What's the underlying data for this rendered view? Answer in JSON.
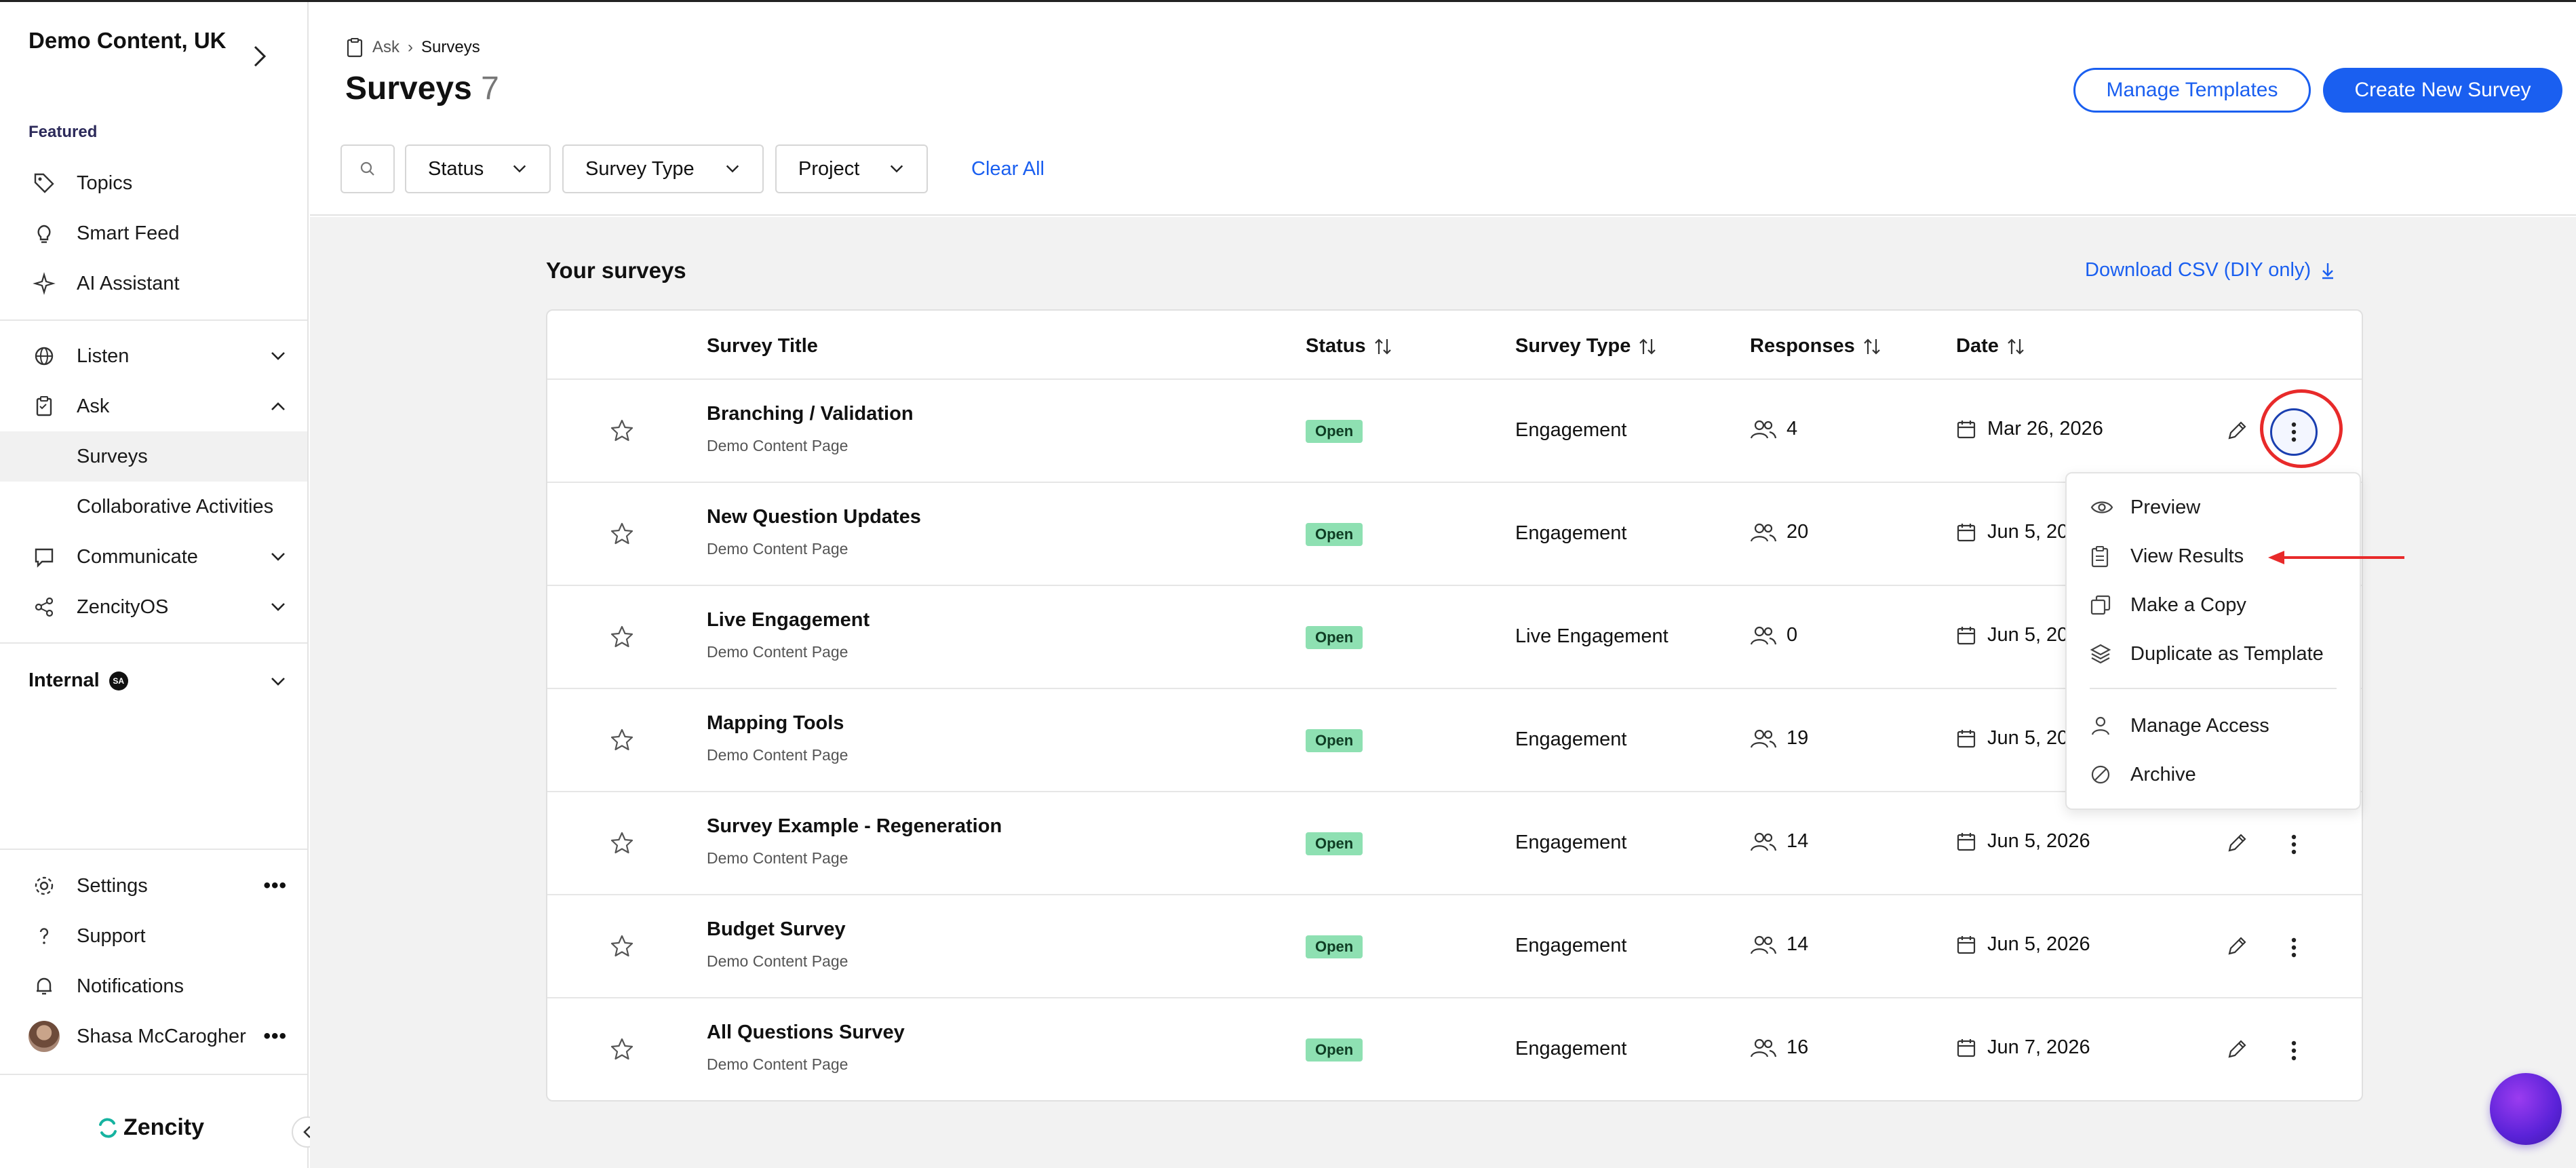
{
  "sidebar": {
    "org_name": "Demo Content, UK",
    "featured_label": "Featured",
    "items": [
      {
        "label": "Topics"
      },
      {
        "label": "Smart Feed"
      },
      {
        "label": "AI Assistant"
      },
      {
        "label": "Listen"
      },
      {
        "label": "Ask"
      },
      {
        "label": "Surveys"
      },
      {
        "label": "Collaborative Activities"
      },
      {
        "label": "Communicate"
      },
      {
        "label": "ZencityOS"
      }
    ],
    "internal_label": "Internal",
    "internal_badge": "SA",
    "bottom": [
      {
        "label": "Settings"
      },
      {
        "label": "Support"
      },
      {
        "label": "Notifications"
      },
      {
        "label": "Shasa McCarogher"
      }
    ],
    "logo_text": "Zencity"
  },
  "header": {
    "breadcrumb": [
      "Ask",
      "Surveys"
    ],
    "title": "Surveys",
    "count": "7",
    "manage_templates": "Manage Templates",
    "create_survey": "Create New Survey",
    "filters": [
      "Status",
      "Survey Type",
      "Project"
    ],
    "clear_all": "Clear All"
  },
  "main": {
    "section_title": "Your surveys",
    "download_csv": "Download CSV (DIY only)",
    "columns": [
      "Survey Title",
      "Status",
      "Survey Type",
      "Responses",
      "Date"
    ],
    "rows": [
      {
        "title": "Branching / Validation",
        "page": "Demo Content Page",
        "status": "Open",
        "type": "Engagement",
        "responses": "4",
        "date": "Mar 26, 2026"
      },
      {
        "title": "New Question Updates",
        "page": "Demo Content Page",
        "status": "Open",
        "type": "Engagement",
        "responses": "20",
        "date": "Jun 5, 2026"
      },
      {
        "title": "Live Engagement",
        "page": "Demo Content Page",
        "status": "Open",
        "type": "Live Engagement",
        "responses": "0",
        "date": "Jun 5, 2026"
      },
      {
        "title": "Mapping Tools",
        "page": "Demo Content Page",
        "status": "Open",
        "type": "Engagement",
        "responses": "19",
        "date": "Jun 5, 2026"
      },
      {
        "title": "Survey Example - Regeneration",
        "page": "Demo Content Page",
        "status": "Open",
        "type": "Engagement",
        "responses": "14",
        "date": "Jun 5, 2026"
      },
      {
        "title": "Budget Survey",
        "page": "Demo Content Page",
        "status": "Open",
        "type": "Engagement",
        "responses": "14",
        "date": "Jun 5, 2026"
      },
      {
        "title": "All Questions Survey",
        "page": "Demo Content Page",
        "status": "Open",
        "type": "Engagement",
        "responses": "16",
        "date": "Jun 7, 2026"
      }
    ]
  },
  "menu": {
    "items": [
      {
        "label": "Preview",
        "icon": "eye-icon"
      },
      {
        "label": "View Results",
        "icon": "clipboard-icon"
      },
      {
        "label": "Make a Copy",
        "icon": "copy-icon"
      },
      {
        "label": "Duplicate as Template",
        "icon": "layers-icon"
      },
      {
        "label": "Manage Access",
        "icon": "user-icon"
      },
      {
        "label": "Archive",
        "icon": "archive-icon"
      }
    ]
  },
  "colors": {
    "accent": "#1a5ff0",
    "status_open": "#8ee0b2",
    "annotation": "#e82a2a"
  }
}
